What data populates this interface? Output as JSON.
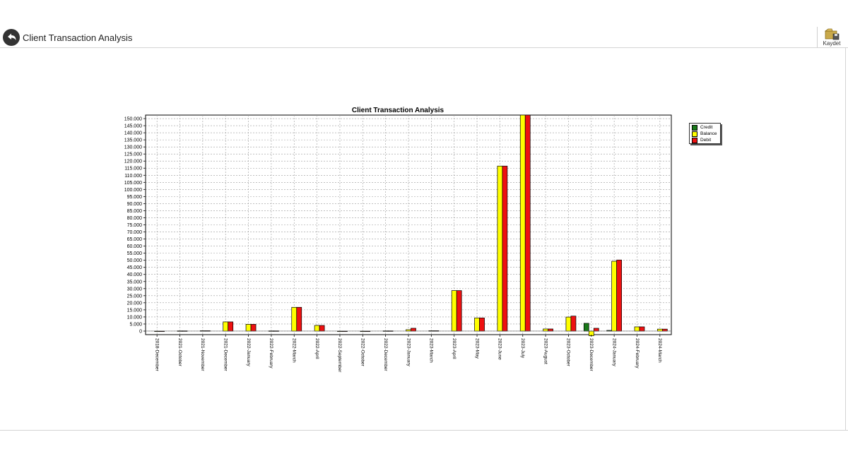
{
  "header": {
    "title": "Client Transaction Analysis",
    "back_icon": "back-arrow-icon",
    "save_icon": "save-folder-icon",
    "save_label": "Kaydet"
  },
  "colors": {
    "credit": "#1a7a1a",
    "balance": "#ffff00",
    "debit": "#ee1111",
    "border": "#d4d4d4"
  },
  "chart_data": {
    "type": "bar",
    "title": "Client Transaction Analysis",
    "xlabel": "",
    "ylabel": "",
    "ylim": [
      -2500,
      152500
    ],
    "y_ticks": [
      "0",
      "5.000",
      "10.000",
      "15.000",
      "20.000",
      "25.000",
      "30.000",
      "35.000",
      "40.000",
      "45.000",
      "50.000",
      "55.000",
      "60.000",
      "65.000",
      "70.000",
      "75.000",
      "80.000",
      "85.000",
      "90.000",
      "95.000",
      "100.000",
      "105.000",
      "110.000",
      "115.000",
      "120.000",
      "125.000",
      "130.000",
      "135.000",
      "140.000",
      "145.000",
      "150.000"
    ],
    "grid": true,
    "legend_position": "right",
    "categories": [
      "2018-December",
      "2021-October",
      "2021-November",
      "2021-December",
      "2022-January",
      "2022-February",
      "2022-March",
      "2022-April",
      "2022-September",
      "2022-October",
      "2022-December",
      "2023-January",
      "2023-March",
      "2023-April",
      "2023-May",
      "2023-June",
      "2023-July",
      "2023-August",
      "2023-October",
      "2023-December",
      "2024-January",
      "2024-February",
      "2024-March"
    ],
    "series": [
      {
        "name": "Credit",
        "color": "#1a7a1a",
        "values": [
          0,
          0,
          0,
          0,
          0,
          0,
          0,
          0,
          0,
          0,
          0,
          0,
          0,
          0,
          0,
          0,
          0,
          0,
          0,
          5500,
          500,
          0,
          0
        ]
      },
      {
        "name": "Balance",
        "color": "#ffff00",
        "values": [
          50,
          200,
          300,
          6500,
          4800,
          200,
          16800,
          4000,
          50,
          50,
          200,
          1000,
          300,
          28600,
          9300,
          116500,
          153000,
          1500,
          9900,
          -3300,
          49300,
          3000,
          1400
        ]
      },
      {
        "name": "Debit",
        "color": "#ee1111",
        "values": [
          50,
          200,
          300,
          6500,
          4800,
          200,
          16800,
          4000,
          50,
          50,
          200,
          2000,
          300,
          28600,
          9300,
          116500,
          153000,
          1500,
          10600,
          2000,
          50200,
          3000,
          1400
        ]
      }
    ]
  }
}
